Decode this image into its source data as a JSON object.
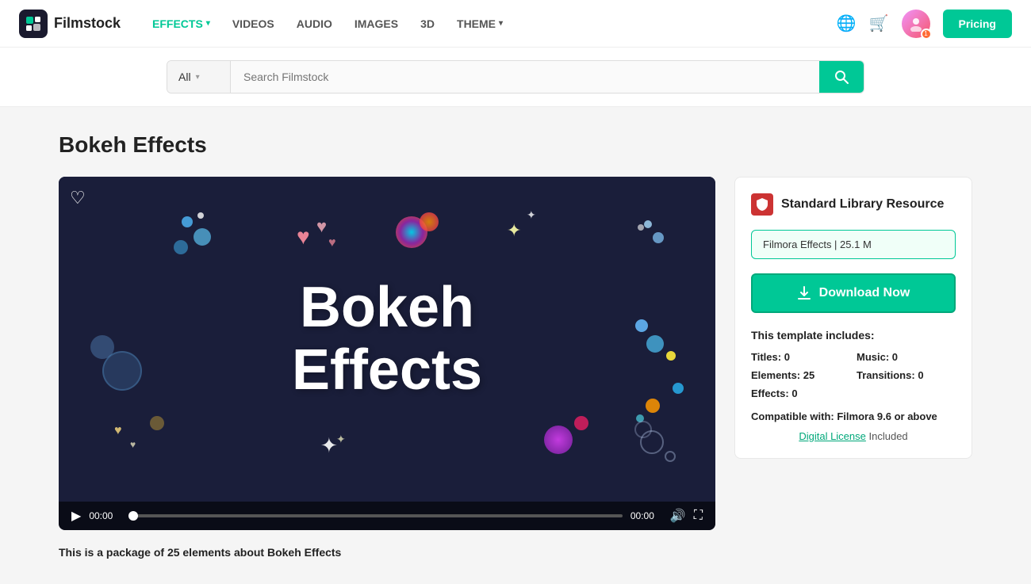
{
  "brand": {
    "logo_letter": "F",
    "name": "Filmstock"
  },
  "nav": {
    "items": [
      {
        "label": "EFFECTS",
        "active": true,
        "has_chevron": true
      },
      {
        "label": "VIDEOS",
        "active": false,
        "has_chevron": false
      },
      {
        "label": "AUDIO",
        "active": false,
        "has_chevron": false
      },
      {
        "label": "IMAGES",
        "active": false,
        "has_chevron": false
      },
      {
        "label": "3D",
        "active": false,
        "has_chevron": false
      },
      {
        "label": "THEME",
        "active": false,
        "has_chevron": true
      }
    ],
    "pricing_button": "Pricing"
  },
  "search": {
    "filter_label": "All",
    "placeholder": "Search Filmstock"
  },
  "page": {
    "title": "Bokeh Effects"
  },
  "video": {
    "title_line1": "Bokeh",
    "title_line2": "Effects",
    "time_start": "00:00",
    "time_end": "00:00",
    "heart_icon": "♡"
  },
  "panel": {
    "library_label": "Standard Library Resource",
    "download_tag": "Filmora Effects | 25.1 M",
    "download_btn": "Download Now",
    "template_includes_title": "This template includes:",
    "titles_label": "Titles:",
    "titles_value": "0",
    "music_label": "Music:",
    "music_value": "0",
    "elements_label": "Elements:",
    "elements_value": "25",
    "transitions_label": "Transitions:",
    "transitions_value": "0",
    "effects_label": "Effects:",
    "effects_value": "0",
    "compatible_label": "Compatible with:",
    "compatible_value": "Filmora 9.6 or above",
    "license_link": "Digital License",
    "license_suffix": " Included"
  },
  "description": "This is a package of 25 elements about Bokeh Effects",
  "colors": {
    "accent": "#00c896",
    "nav_bg": "#ffffff",
    "video_bg": "#1a1e3a"
  }
}
